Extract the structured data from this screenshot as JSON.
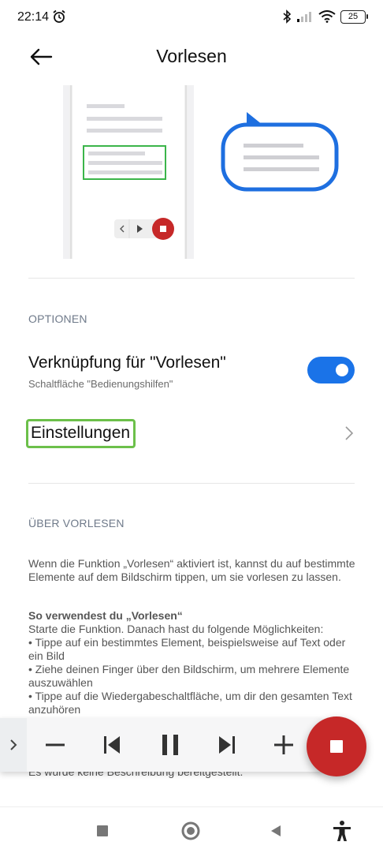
{
  "status": {
    "time": "22:14",
    "battery": "25"
  },
  "header": {
    "title": "Vorlesen"
  },
  "options": {
    "header": "OPTIONEN",
    "shortcut_title": "Verknüpfung für \"Vorlesen\"",
    "shortcut_subtitle": "Schaltfläche \"Bedienungshilfen\"",
    "shortcut_enabled": true,
    "settings_label": "Einstellungen"
  },
  "about": {
    "header": "ÜBER VORLESEN",
    "intro": "Wenn die Funktion „Vorlesen“ aktiviert ist, kannst du auf bestimmte Elemente auf dem Bildschirm tippen, um sie vorlesen zu lassen.",
    "howto_title": "So verwendest du „Vorlesen“",
    "howto_line1": "Starte die Funktion. Danach hast du folgende Möglichkeiten:",
    "howto_line2": "• Tippe auf ein bestimmtes Element, beispielsweise auf Text oder ein Bild",
    "howto_line3": "• Ziehe deinen Finger über den Bildschirm, um mehrere Elemente auszuwählen",
    "howto_line4": "• Tippe auf die Wiedergabeschaltfläche, um dir den gesamten Text anzuhören",
    "no_description": "Es wurde keine Beschreibung bereitgestellt."
  },
  "colors": {
    "accent": "#1a73e8",
    "stop_red": "#c62828",
    "highlight_green": "#6cc04a",
    "speech_bubble_blue": "#1e6fe0"
  },
  "icons": {
    "back": "arrow-left-icon",
    "chevron": "chevron-right-icon",
    "player": [
      "chevron-right-icon",
      "minus-icon",
      "skip-previous-icon",
      "pause-icon",
      "skip-next-icon",
      "plus-icon",
      "stop-icon"
    ],
    "nav": [
      "square-icon",
      "circle-icon",
      "triangle-back-icon",
      "accessibility-icon"
    ]
  }
}
